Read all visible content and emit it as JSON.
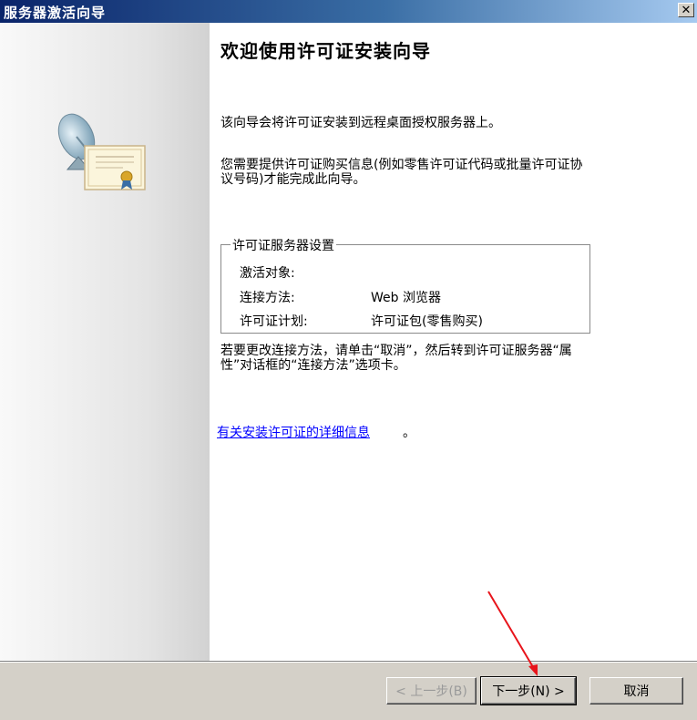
{
  "window": {
    "title": "服务器激活向导",
    "close_glyph": "✕"
  },
  "main": {
    "heading": "欢迎使用许可证安装向导",
    "intro": "该向导会将许可证安装到远程桌面授权服务器上。",
    "requirement": "您需要提供许可证购买信息(例如零售许可证代码或批量许可证协议号码)才能完成此向导。",
    "settings": {
      "title": "许可证服务器设置",
      "rows": [
        {
          "label": "激活对象:",
          "value": ""
        },
        {
          "label": "连接方法:",
          "value": "Web 浏览器"
        },
        {
          "label": "许可证计划:",
          "value": "许可证包(零售购买)"
        }
      ]
    },
    "change_note": "若要更改连接方法，请单击“取消”，然后转到许可证服务器“属性”对话框的“连接方法”选项卡。",
    "info_link": "有关安装许可证的详细信息",
    "info_link_suffix": "。"
  },
  "buttons": {
    "back": "< 上一步(B)",
    "next": "下一步(N) >",
    "cancel": "取消"
  },
  "annotation": {
    "arrow_color": "#e8141b"
  }
}
